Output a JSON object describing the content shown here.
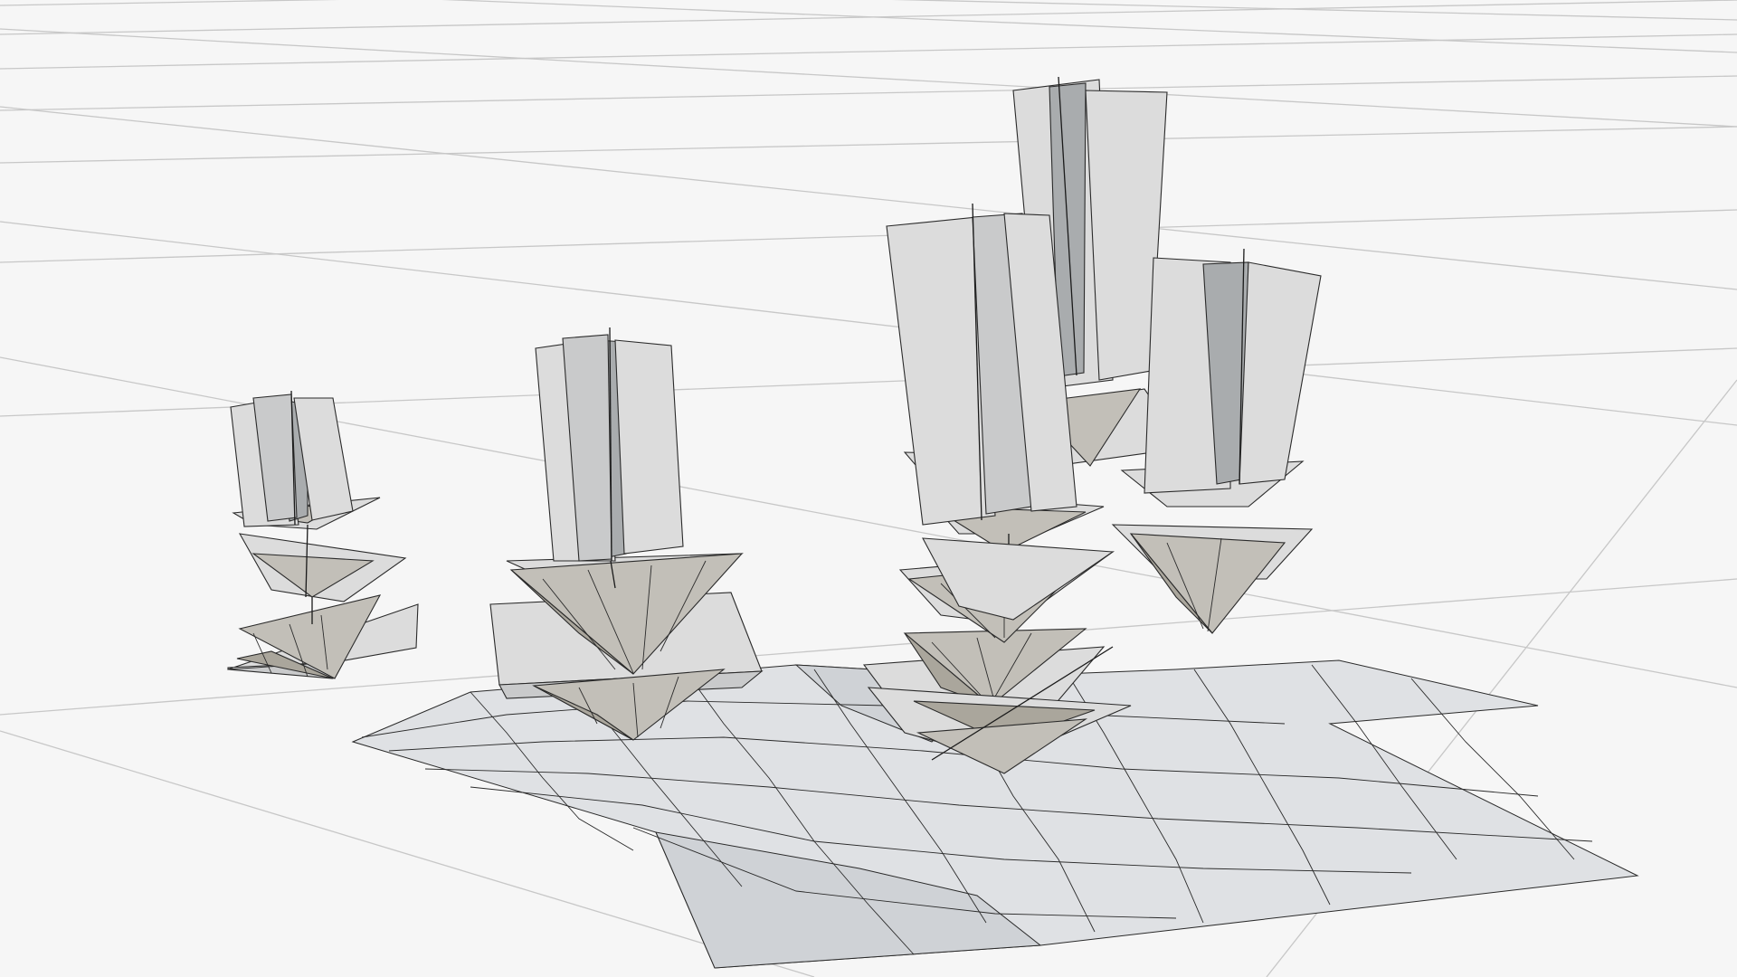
{
  "viewport": {
    "background": "#f6f6f6",
    "grid_color": "#c7c7c7",
    "surface_color": "#dcdcdc",
    "wire_color": "#2a2a2a"
  }
}
